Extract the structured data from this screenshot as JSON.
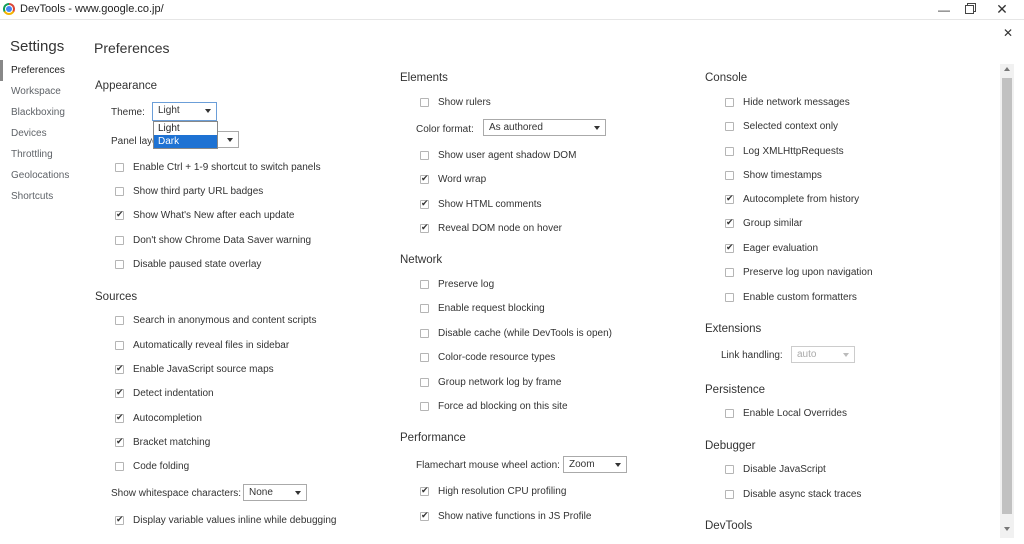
{
  "window": {
    "title": "DevTools - www.google.co.jp/"
  },
  "settings_title": "Settings",
  "page_title": "Preferences",
  "sidebar": {
    "items": [
      {
        "label": "Preferences"
      },
      {
        "label": "Workspace"
      },
      {
        "label": "Blackboxing"
      },
      {
        "label": "Devices"
      },
      {
        "label": "Throttling"
      },
      {
        "label": "Geolocations"
      },
      {
        "label": "Shortcuts"
      }
    ]
  },
  "appearance": {
    "title": "Appearance",
    "theme_label": "Theme:",
    "theme_value": "Light",
    "theme_options": [
      "Light",
      "Dark"
    ],
    "panel_layout_label": "Panel layo",
    "checkboxes": [
      {
        "label": "Enable Ctrl + 1-9 shortcut to switch panels",
        "checked": false
      },
      {
        "label": "Show third party URL badges",
        "checked": false
      },
      {
        "label": "Show What's New after each update",
        "checked": true
      },
      {
        "label": "Don't show Chrome Data Saver warning",
        "checked": false
      },
      {
        "label": "Disable paused state overlay",
        "checked": false
      }
    ]
  },
  "sources": {
    "title": "Sources",
    "checkboxes": [
      {
        "label": "Search in anonymous and content scripts",
        "checked": false
      },
      {
        "label": "Automatically reveal files in sidebar",
        "checked": false
      },
      {
        "label": "Enable JavaScript source maps",
        "checked": true
      },
      {
        "label": "Detect indentation",
        "checked": true
      },
      {
        "label": "Autocompletion",
        "checked": true
      },
      {
        "label": "Bracket matching",
        "checked": true
      },
      {
        "label": "Code folding",
        "checked": false
      }
    ],
    "whitespace_label": "Show whitespace characters:",
    "whitespace_value": "None",
    "inline_values": {
      "label": "Display variable values inline while debugging",
      "checked": true
    }
  },
  "elements": {
    "title": "Elements",
    "show_rulers": {
      "label": "Show rulers",
      "checked": false
    },
    "color_format_label": "Color format:",
    "color_format_value": "As authored",
    "checkboxes": [
      {
        "label": "Show user agent shadow DOM",
        "checked": false
      },
      {
        "label": "Word wrap",
        "checked": true
      },
      {
        "label": "Show HTML comments",
        "checked": true
      },
      {
        "label": "Reveal DOM node on hover",
        "checked": true
      }
    ]
  },
  "network": {
    "title": "Network",
    "checkboxes": [
      {
        "label": "Preserve log",
        "checked": false
      },
      {
        "label": "Enable request blocking",
        "checked": false
      },
      {
        "label": "Disable cache (while DevTools is open)",
        "checked": false
      },
      {
        "label": "Color-code resource types",
        "checked": false
      },
      {
        "label": "Group network log by frame",
        "checked": false
      },
      {
        "label": "Force ad blocking on this site",
        "checked": false
      }
    ]
  },
  "performance": {
    "title": "Performance",
    "flamechart_label": "Flamechart mouse wheel action:",
    "flamechart_value": "Zoom",
    "checkboxes": [
      {
        "label": "High resolution CPU profiling",
        "checked": true
      },
      {
        "label": "Show native functions in JS Profile",
        "checked": true
      }
    ]
  },
  "console": {
    "title": "Console",
    "checkboxes": [
      {
        "label": "Hide network messages",
        "checked": false
      },
      {
        "label": "Selected context only",
        "checked": false
      },
      {
        "label": "Log XMLHttpRequests",
        "checked": false
      },
      {
        "label": "Show timestamps",
        "checked": false
      },
      {
        "label": "Autocomplete from history",
        "checked": true
      },
      {
        "label": "Group similar",
        "checked": true
      },
      {
        "label": "Eager evaluation",
        "checked": true
      },
      {
        "label": "Preserve log upon navigation",
        "checked": false
      },
      {
        "label": "Enable custom formatters",
        "checked": false
      }
    ]
  },
  "extensions": {
    "title": "Extensions",
    "link_handling_label": "Link handling:",
    "link_handling_value": "auto"
  },
  "persistence": {
    "title": "Persistence",
    "local_overrides": {
      "label": "Enable Local Overrides",
      "checked": false
    }
  },
  "debugger": {
    "title": "Debugger",
    "checkboxes": [
      {
        "label": "Disable JavaScript",
        "checked": false
      },
      {
        "label": "Disable async stack traces",
        "checked": false
      }
    ]
  },
  "devtools": {
    "title": "DevTools"
  }
}
